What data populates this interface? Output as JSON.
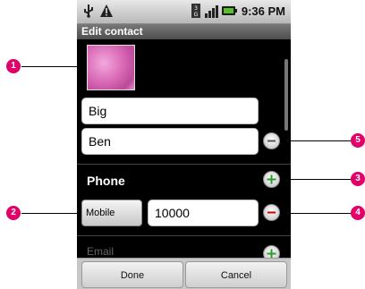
{
  "status": {
    "time": "9:36 PM",
    "icons": [
      "usb-icon",
      "warning-icon",
      "3g-icon",
      "signal-icon",
      "battery-icon"
    ]
  },
  "title": "Edit contact",
  "fields": {
    "first_name": "Big",
    "last_name": "Ben"
  },
  "phone": {
    "section_label": "Phone",
    "type_label": "Mobile",
    "number": "10000"
  },
  "email": {
    "section_label": "Email"
  },
  "buttons": {
    "done": "Done",
    "cancel": "Cancel"
  },
  "callouts": [
    "1",
    "2",
    "3",
    "4",
    "5"
  ],
  "colors": {
    "callout": "#e1006a",
    "add": "#2e9a2e",
    "remove": "#d40000"
  }
}
